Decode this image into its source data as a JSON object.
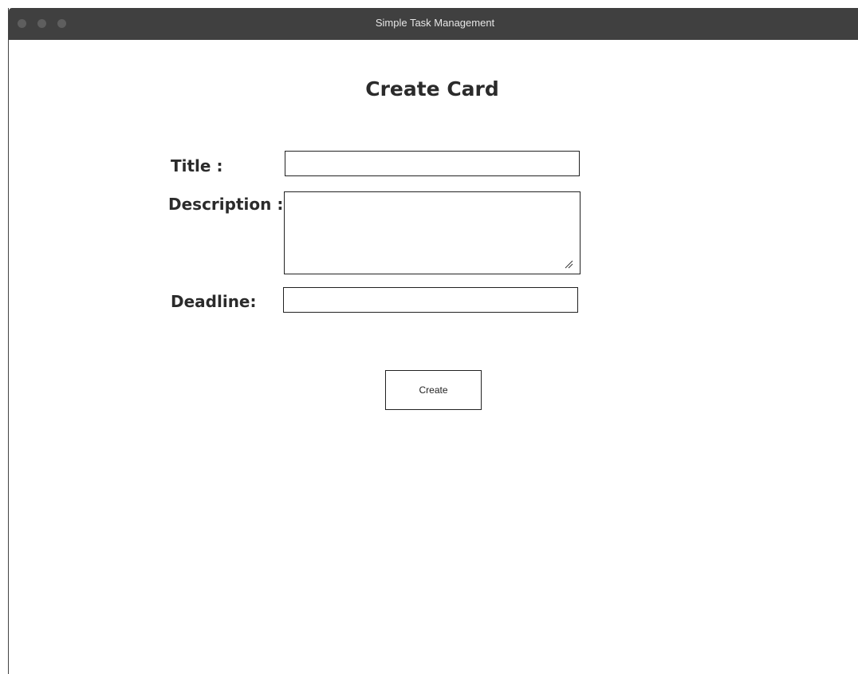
{
  "window": {
    "title": "Simple Task Management"
  },
  "page": {
    "title": "Create Card"
  },
  "form": {
    "title_label": "Title :",
    "title_value": "",
    "description_label": "Description :",
    "description_value": "",
    "deadline_label": "Deadline:",
    "deadline_value": "",
    "create_label": "Create"
  }
}
